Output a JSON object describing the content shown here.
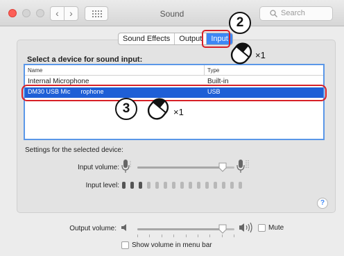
{
  "window": {
    "title": "Sound"
  },
  "search": {
    "placeholder": "Search"
  },
  "tabs": [
    {
      "label": "Sound Effects"
    },
    {
      "label": "Output"
    },
    {
      "label": "Input"
    }
  ],
  "input_panel": {
    "section_title": "Select a device for sound input:",
    "columns": {
      "name": "Name",
      "type": "Type"
    },
    "devices": [
      {
        "name": "Internal Microphone",
        "type": "Built-in",
        "selected": false
      },
      {
        "name": "DM30 USB Mic      rophone",
        "type": "USB",
        "selected": true
      }
    ],
    "settings_label": "Settings for the selected device:",
    "input_volume_label": "Input volume:",
    "input_volume_level": 0.88,
    "input_level_label": "Input level:",
    "input_level_segments": 15,
    "input_level_active": 3
  },
  "help": {
    "label": "?"
  },
  "output": {
    "volume_label": "Output volume:",
    "volume_level": 0.88,
    "mute_label": "Mute",
    "mute_checked": false,
    "show_volume_label": "Show volume in menu bar",
    "show_volume_checked": false
  },
  "annotations": {
    "step2": {
      "number": "2",
      "clicks": "×1"
    },
    "step3": {
      "number": "3",
      "clicks": "×1"
    }
  },
  "colors": {
    "accent": "#3d87f5",
    "selection": "#1e5fd6",
    "highlight": "#d72027",
    "close": "#fc5f57"
  }
}
